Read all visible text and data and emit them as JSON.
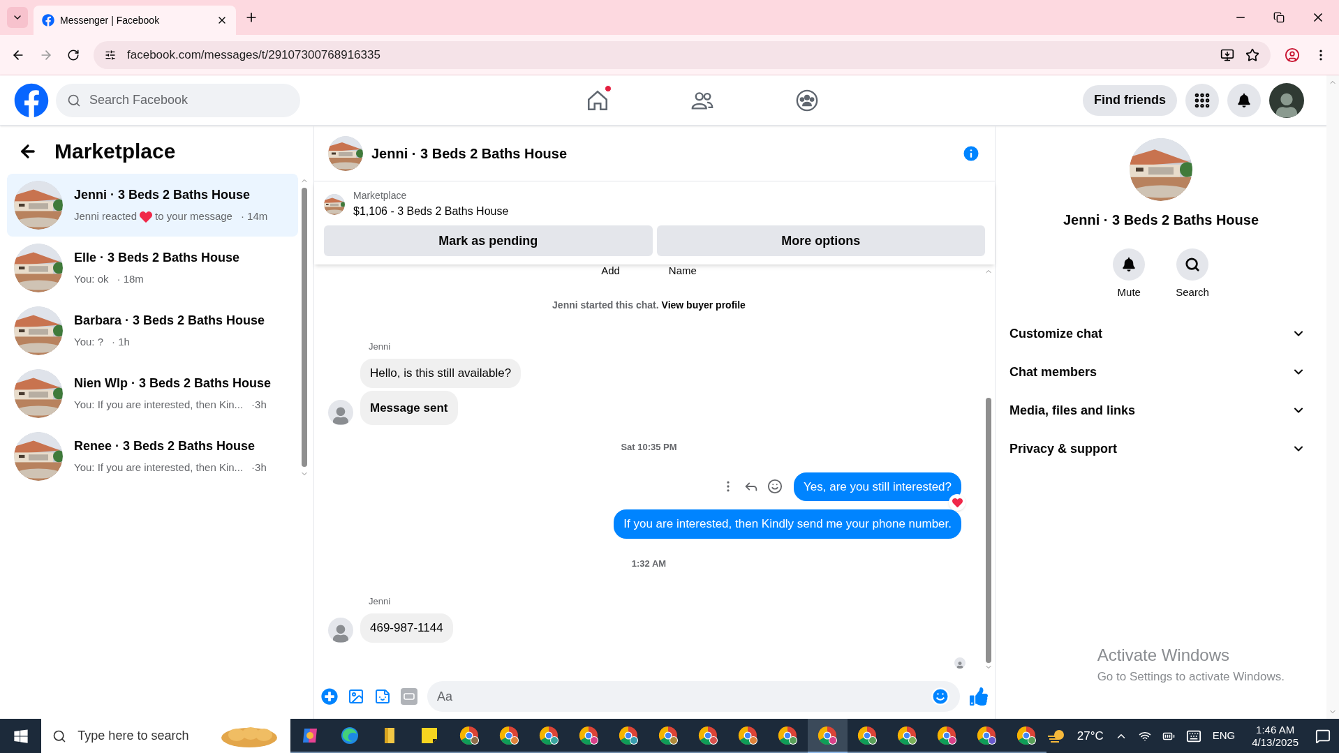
{
  "browser": {
    "tab_title": "Messenger | Facebook",
    "url": "facebook.com/messages/t/29107300768916335"
  },
  "header": {
    "search_placeholder": "Search Facebook",
    "nav": [
      {
        "kind": "home",
        "notification": true
      },
      {
        "kind": "friends",
        "notification": false
      },
      {
        "kind": "groups",
        "notification": false
      }
    ],
    "find_friends": "Find friends"
  },
  "sidebar": {
    "title": "Marketplace",
    "conversations": [
      {
        "name": "Jenni · 3 Beds 2 Baths House",
        "preview": "Jenni reacted",
        "reaction": true,
        "preview_end": "to your message",
        "time": "· 14m",
        "selected": true
      },
      {
        "name": "Elle · 3 Beds 2 Baths House",
        "preview": "You: ok",
        "reaction": false,
        "time": "· 18m",
        "selected": false
      },
      {
        "name": "Barbara · 3 Beds 2 Baths House",
        "preview": "You: ?",
        "reaction": false,
        "time": "· 1h",
        "selected": false
      },
      {
        "name": "Nien Wlp · 3 Beds 2 Baths House",
        "preview": "You: If you are interested, then Kin...",
        "reaction": false,
        "time": "·3h",
        "selected": false
      },
      {
        "name": "Renee · 3 Beds 2 Baths House",
        "preview": "You: If you are interested, then Kin...",
        "reaction": false,
        "time": "·3h",
        "selected": false
      }
    ]
  },
  "chat": {
    "title": "Jenni · 3 Beds 2 Baths House",
    "listing": {
      "label": "Marketplace",
      "title": "$1,106 - 3 Beds 2 Baths House",
      "buttons": [
        "Mark as pending",
        "More options"
      ]
    },
    "cut_labels": [
      "Add",
      "Name"
    ],
    "messages": [
      {
        "kind": "system",
        "text": "Jenni started this chat.",
        "link": "View buyer profile"
      },
      {
        "kind": "sender",
        "text": "Jenni"
      },
      {
        "kind": "incoming",
        "text": "Hello, is this still available?",
        "avatar": false,
        "bold": false
      },
      {
        "kind": "incoming",
        "text": "Message sent",
        "avatar": true,
        "bold": true
      },
      {
        "kind": "timestamp",
        "text": "Sat 10:35 PM"
      },
      {
        "kind": "outgoing",
        "text": "Yes, are you still interested?",
        "reaction": true,
        "hover_actions": true
      },
      {
        "kind": "outgoing",
        "text": "If you are interested, then Kindly send me your phone number.",
        "reaction": false,
        "hover_actions": false
      },
      {
        "kind": "timestamp",
        "text": "1:32 AM"
      },
      {
        "kind": "sender",
        "text": "Jenni"
      },
      {
        "kind": "incoming",
        "text": "469-987-1144",
        "avatar": true,
        "bold": false
      }
    ],
    "composer": {
      "placeholder": "Aa"
    }
  },
  "details": {
    "title": "Jenni · 3 Beds 2 Baths House",
    "actions": [
      {
        "kind": "mute",
        "label": "Mute"
      },
      {
        "kind": "search",
        "label": "Search"
      }
    ],
    "sections": [
      {
        "label": "Customize chat",
        "expanded": false
      },
      {
        "label": "Chat members",
        "expanded": false
      },
      {
        "label": "Media, files and links",
        "expanded": false
      },
      {
        "label": "Privacy & support",
        "expanded": false
      }
    ]
  },
  "activation": {
    "title": "Activate Windows",
    "subtitle": "Go to Settings to activate Windows."
  },
  "taskbar": {
    "search_placeholder": "Type here to search",
    "apps": [
      {
        "kind": "copilot",
        "selected": false
      },
      {
        "kind": "edge",
        "selected": false
      },
      {
        "kind": "explorer",
        "selected": false
      },
      {
        "kind": "notes",
        "selected": false
      },
      {
        "kind": "chrome",
        "color": "#8d6e4a",
        "selected": false
      },
      {
        "kind": "chrome",
        "color": "#e0833a",
        "selected": false
      },
      {
        "kind": "chrome",
        "color": "#3aa6a0",
        "selected": false
      },
      {
        "kind": "chrome",
        "color": "#d9418a",
        "selected": false
      },
      {
        "kind": "chrome",
        "color": "#3a9fb0",
        "selected": false
      },
      {
        "kind": "chrome",
        "color": "#b08a3a",
        "selected": false
      },
      {
        "kind": "chrome",
        "color": "#d9534f",
        "selected": false
      },
      {
        "kind": "chrome",
        "color": "#e0833a",
        "selected": false
      },
      {
        "kind": "chrome",
        "color": "#5aa05a",
        "selected": false
      },
      {
        "kind": "chrome",
        "color": "#d9418a",
        "selected": true
      },
      {
        "kind": "chrome",
        "color": "#5aa05a",
        "selected": false
      },
      {
        "kind": "chrome",
        "color": "#7bb05a",
        "selected": false
      },
      {
        "kind": "chrome",
        "color": "#d9418a",
        "selected": false
      },
      {
        "kind": "chrome",
        "color": "#6a5acd",
        "selected": false
      },
      {
        "kind": "chrome",
        "color": "#5aa05a",
        "selected": false
      }
    ],
    "temperature": "27°C",
    "language": "ENG",
    "time": "1:46 AM",
    "date": "4/13/2025"
  }
}
